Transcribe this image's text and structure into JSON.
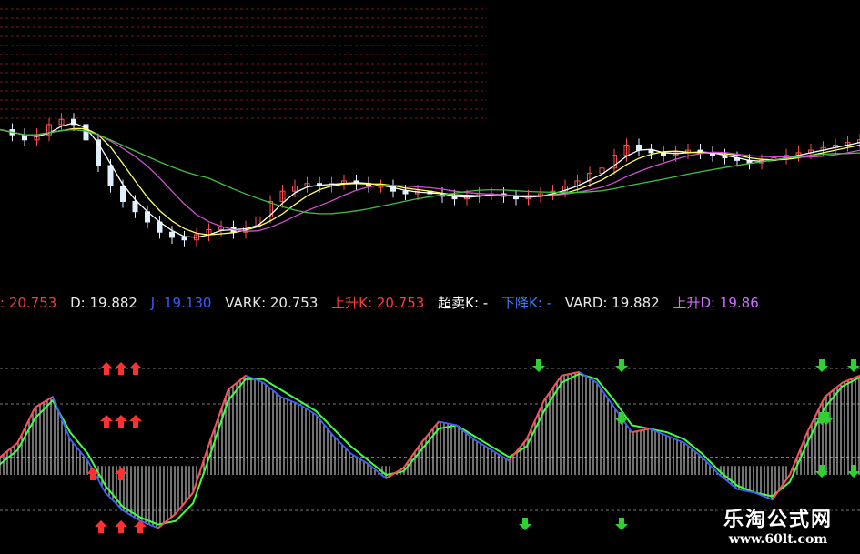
{
  "indicator_bar": [
    {
      "text": ": 20.753",
      "color": "#e04040"
    },
    {
      "text": "D: 19.882",
      "color": "#e8e8e8"
    },
    {
      "text": "J: 19.130",
      "color": "#3a5cff"
    },
    {
      "text": "VARK: 20.753",
      "color": "#e8e8e8"
    },
    {
      "text": "上升K: 20.753",
      "color": "#ff3a3a"
    },
    {
      "text": "超卖K: -",
      "color": "#ffffff"
    },
    {
      "text": "下降K: -",
      "color": "#3a7cff"
    },
    {
      "text": "VARD: 19.882",
      "color": "#e8e8e8"
    },
    {
      "text": "上升D: 19.86",
      "color": "#d070ff"
    }
  ],
  "watermark": {
    "title": "乐淘公式网",
    "url": "www.60lt.com"
  },
  "colors": {
    "background": "#000000",
    "grid": "#7a1a1a",
    "ma_short": "#ffffff",
    "ma_mid": "#ffff60",
    "ma_long1": "#d050d0",
    "ma_long2": "#40c040",
    "k_up": "#ff5050",
    "k_down": "#4060ff",
    "d_line": "#40ff40",
    "histogram": "#dcdcdc",
    "buy_arrow": "#ff3030",
    "sell_arrow": "#30d030"
  },
  "chart_data": [
    {
      "type": "candlestick",
      "price": [
        62,
        60,
        58,
        60,
        64,
        66,
        64,
        58,
        48,
        40,
        34,
        30,
        26,
        22,
        20,
        19,
        21,
        23,
        24,
        22,
        24,
        28,
        34,
        38,
        40,
        41,
        40,
        41,
        42,
        41,
        40,
        40,
        38,
        37,
        38,
        37,
        36,
        35,
        36,
        37,
        37,
        36,
        35,
        36,
        37,
        38,
        40,
        42,
        45,
        47,
        52,
        56,
        54,
        53,
        52,
        53,
        54,
        53,
        52,
        51,
        50,
        49,
        50,
        51,
        52,
        53,
        54,
        55,
        56,
        57,
        58
      ],
      "ma_lines": [
        "MA5",
        "MA10",
        "MA20",
        "MA60"
      ]
    },
    {
      "type": "line",
      "series": [
        {
          "name": "K",
          "values": [
            50,
            58,
            78,
            84,
            60,
            48,
            30,
            20,
            14,
            10,
            18,
            30,
            60,
            88,
            96,
            92,
            84,
            80,
            74,
            62,
            52,
            46,
            38,
            44,
            58,
            70,
            68,
            60,
            54,
            48,
            60,
            82,
            96,
            98,
            92,
            78,
            64,
            66,
            62,
            58,
            50,
            40,
            32,
            30,
            26,
            40,
            64,
            84,
            92,
            96
          ]
        },
        {
          "name": "D",
          "values": [
            46,
            54,
            72,
            82,
            64,
            52,
            34,
            22,
            16,
            12,
            14,
            24,
            52,
            82,
            94,
            94,
            88,
            82,
            76,
            66,
            56,
            48,
            40,
            42,
            54,
            66,
            68,
            62,
            56,
            50,
            56,
            76,
            92,
            97,
            94,
            82,
            68,
            66,
            64,
            60,
            52,
            42,
            34,
            30,
            28,
            36,
            58,
            78,
            90,
            95
          ]
        }
      ],
      "ylim": [
        0,
        100
      ],
      "reference_levels": [
        20,
        50,
        80,
        100
      ]
    }
  ]
}
